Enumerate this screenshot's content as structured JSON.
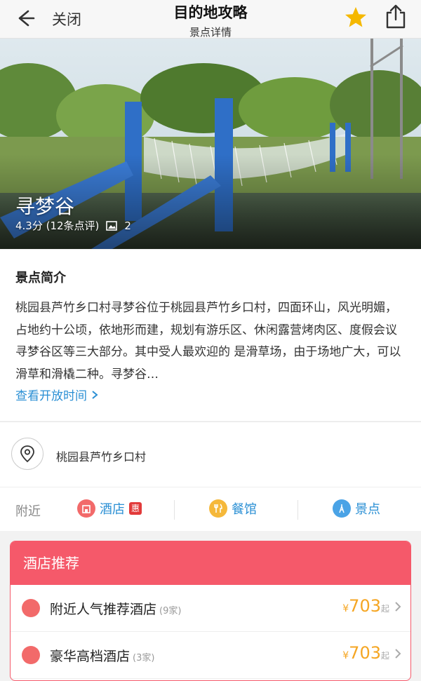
{
  "header": {
    "close_label": "关闭",
    "title": "目的地攻略",
    "subtitle": "景点详情"
  },
  "hero": {
    "name": "寻梦谷",
    "rating_text": "4.3分 (12条点评)",
    "photo_count": "2"
  },
  "intro": {
    "heading": "景点简介",
    "text": "桃园县芦竹乡口村寻梦谷位于桃园县芦竹乡口村，四面环山，风光明媚，占地约十公顷，依地形而建，规划有游乐区、休闲露营烤肉区、度假会议寻梦谷区等三大部分。其中受人最欢迎的 是滑草场，由于场地广大，可以滑草和滑橇二种。寻梦谷…",
    "hours_link": "查看开放时间"
  },
  "address": {
    "text": "桃园县芦竹乡口村"
  },
  "nearby": {
    "label": "附近",
    "hotel": "酒店",
    "hotel_badge": "惠",
    "restaurant": "餐馆",
    "sight": "景点"
  },
  "hotel_card": {
    "title": "酒店推荐",
    "rows": [
      {
        "name": "附近人气推荐酒店",
        "count": "(9家)",
        "currency": "¥",
        "price": "703",
        "suffix": "起"
      },
      {
        "name": "豪华高档酒店",
        "count": "(3家)",
        "currency": "¥",
        "price": "703",
        "suffix": "起"
      }
    ]
  },
  "colors": {
    "accent_blue": "#2a8fd4",
    "card_red": "#f5596a",
    "price_orange": "#f5a623",
    "star_yellow": "#f5b800"
  }
}
